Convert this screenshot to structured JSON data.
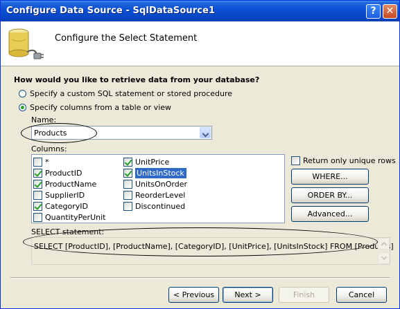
{
  "window": {
    "title": "Configure Data Source - SqlDataSource1"
  },
  "title_buttons": {
    "help": "?",
    "close": "✕"
  },
  "header": {
    "title": "Configure the Select Statement",
    "icon": "database-plug-icon"
  },
  "question": "How would you like to retrieve data from your database?",
  "options": [
    {
      "label": "Specify a custom SQL statement or stored procedure",
      "selected": false
    },
    {
      "label": "Specify columns from a table or view",
      "selected": true
    }
  ],
  "name_field": {
    "label": "Name:",
    "value": "Products"
  },
  "columns": {
    "label": "Columns:",
    "items": [
      {
        "label": "*",
        "checked": false
      },
      {
        "label": "ProductID",
        "checked": true
      },
      {
        "label": "ProductName",
        "checked": true
      },
      {
        "label": "SupplierID",
        "checked": false
      },
      {
        "label": "CategoryID",
        "checked": true
      },
      {
        "label": "QuantityPerUnit",
        "checked": false
      },
      {
        "label": "UnitPrice",
        "checked": true
      },
      {
        "label": "UnitsInStock",
        "checked": true
      },
      {
        "label": "UnitsOnOrder",
        "checked": false
      },
      {
        "label": "ReorderLevel",
        "checked": false
      },
      {
        "label": "Discontinued",
        "checked": false
      }
    ]
  },
  "unique_rows": {
    "label": "Return only unique rows",
    "checked": false
  },
  "side_buttons": {
    "where": "WHERE...",
    "order_by": "ORDER BY...",
    "advanced": "Advanced..."
  },
  "select_statement": {
    "label": "SELECT statement:",
    "sql": "SELECT [ProductID], [ProductName], [CategoryID], [UnitPrice], [UnitsInStock] FROM [Products]"
  },
  "footer": {
    "previous": "< Previous",
    "next": "Next >",
    "finish": "Finish",
    "cancel": "Cancel"
  },
  "colors": {
    "title_bar": "#0a4fd4",
    "dialog_bg": "#ece9d8",
    "selection": "#316ac5",
    "check": "#21a121"
  }
}
